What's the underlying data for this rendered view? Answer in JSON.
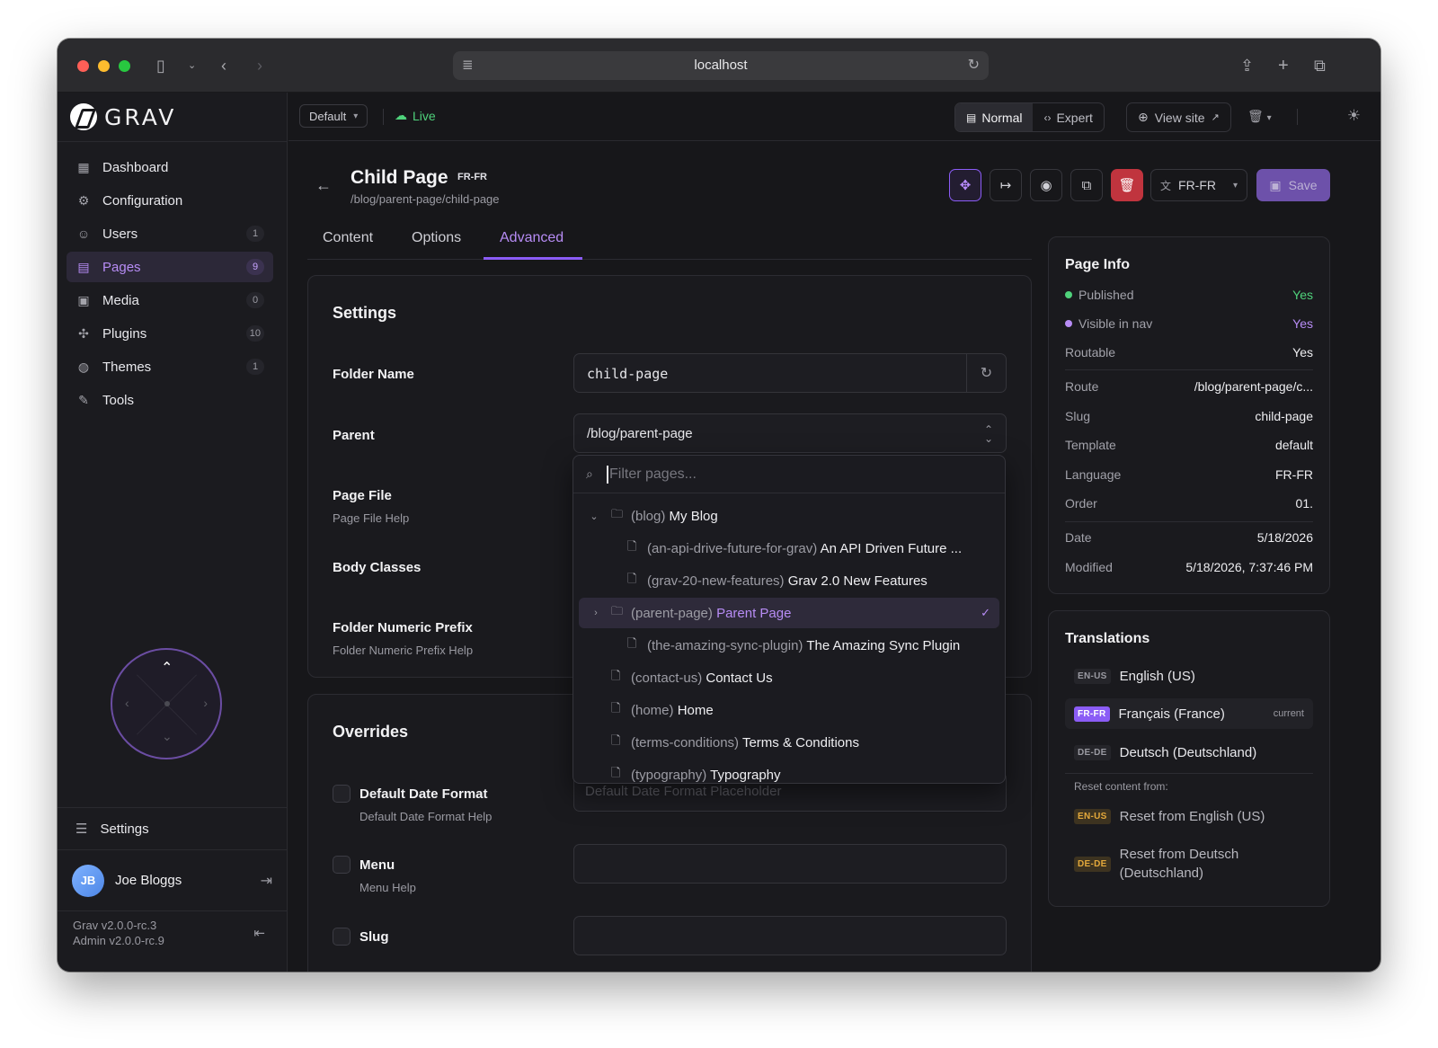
{
  "browser": {
    "url": "localhost"
  },
  "sidebar": {
    "brand": "GRAV",
    "items": [
      {
        "label": "Dashboard",
        "icon": "dashboard-icon",
        "count": ""
      },
      {
        "label": "Configuration",
        "icon": "gear-icon",
        "count": ""
      },
      {
        "label": "Users",
        "icon": "users-icon",
        "count": "1"
      },
      {
        "label": "Pages",
        "icon": "page-icon",
        "count": "9",
        "active": true
      },
      {
        "label": "Media",
        "icon": "image-icon",
        "count": "0"
      },
      {
        "label": "Plugins",
        "icon": "puzzle-icon",
        "count": "10"
      },
      {
        "label": "Themes",
        "icon": "palette-icon",
        "count": "1"
      },
      {
        "label": "Tools",
        "icon": "wrench-icon",
        "count": ""
      }
    ],
    "settings_label": "Settings",
    "user": {
      "initials": "JB",
      "name": "Joe Bloggs"
    },
    "version_line1": "Grav v2.0.0-rc.3",
    "version_line2": "Admin v2.0.0-rc.9"
  },
  "topbar": {
    "environment": "Default",
    "status": "Live",
    "mode_normal": "Normal",
    "mode_expert": "Expert",
    "view_site": "View site"
  },
  "page": {
    "title": "Child Page",
    "lang": "FR-FR",
    "route": "/blog/parent-page/child-page",
    "lang_select": "FR-FR",
    "save_label": "Save"
  },
  "tabs": [
    "Content",
    "Options",
    "Advanced"
  ],
  "settings": {
    "title": "Settings",
    "folder_name_label": "Folder Name",
    "folder_name_value": "child-page",
    "parent_label": "Parent",
    "parent_value": "/blog/parent-page",
    "page_file_label": "Page File",
    "page_file_help": "Page File Help",
    "body_classes_label": "Body Classes",
    "folder_prefix_label": "Folder Numeric Prefix",
    "folder_prefix_help": "Folder Numeric Prefix Help"
  },
  "overrides": {
    "title": "Overrides",
    "date_format_label": "Default Date Format",
    "date_format_help": "Default Date Format Help",
    "date_format_placeholder": "Default Date Format Placeholder",
    "menu_label": "Menu",
    "menu_help": "Menu Help",
    "slug_label": "Slug"
  },
  "dropdown": {
    "placeholder": "Filter pages...",
    "items": [
      {
        "slug": "(blog)",
        "title": "My Blog",
        "type": "folder",
        "expanded": true,
        "depth": 0
      },
      {
        "slug": "(an-api-drive-future-for-grav)",
        "title": "An API Driven Future ...",
        "type": "file",
        "depth": 1
      },
      {
        "slug": "(grav-20-new-features)",
        "title": "Grav 2.0 New Features",
        "type": "file",
        "depth": 1
      },
      {
        "slug": "(parent-page)",
        "title": "Parent Page",
        "type": "folder",
        "collapsed": true,
        "depth": 1,
        "selected": true
      },
      {
        "slug": "(the-amazing-sync-plugin)",
        "title": "The Amazing Sync Plugin",
        "type": "file",
        "depth": 1
      },
      {
        "slug": "(contact-us)",
        "title": "Contact Us",
        "type": "file",
        "depth": 0
      },
      {
        "slug": "(home)",
        "title": "Home",
        "type": "file",
        "depth": 0
      },
      {
        "slug": "(terms-conditions)",
        "title": "Terms & Conditions",
        "type": "file",
        "depth": 0
      },
      {
        "slug": "(typography)",
        "title": "Typography",
        "type": "file",
        "depth": 0
      }
    ]
  },
  "page_info": {
    "title": "Page Info",
    "published_label": "Published",
    "published_value": "Yes",
    "visible_label": "Visible in nav",
    "visible_value": "Yes",
    "routable_label": "Routable",
    "routable_value": "Yes",
    "route_label": "Route",
    "route_value": "/blog/parent-page/c...",
    "slug_label": "Slug",
    "slug_value": "child-page",
    "template_label": "Template",
    "template_value": "default",
    "language_label": "Language",
    "language_value": "FR-FR",
    "order_label": "Order",
    "order_value": "01.",
    "date_label": "Date",
    "date_value": "5/18/2026",
    "modified_label": "Modified",
    "modified_value": "5/18/2026, 7:37:46 PM",
    "colors": {
      "green": "#4fd27b",
      "purple": "#b78cf5"
    }
  },
  "translations": {
    "title": "Translations",
    "items": [
      {
        "code": "EN-US",
        "name": "English (US)"
      },
      {
        "code": "FR-FR",
        "name": "Français (France)",
        "current": "current"
      },
      {
        "code": "DE-DE",
        "name": "Deutsch (Deutschland)"
      }
    ],
    "reset_label": "Reset content from:",
    "reset_items": [
      {
        "code": "EN-US",
        "name": "Reset from English (US)"
      },
      {
        "code": "DE-DE",
        "name_line1": "Reset from Deutsch",
        "name_line2": "(Deutschland)"
      }
    ]
  }
}
